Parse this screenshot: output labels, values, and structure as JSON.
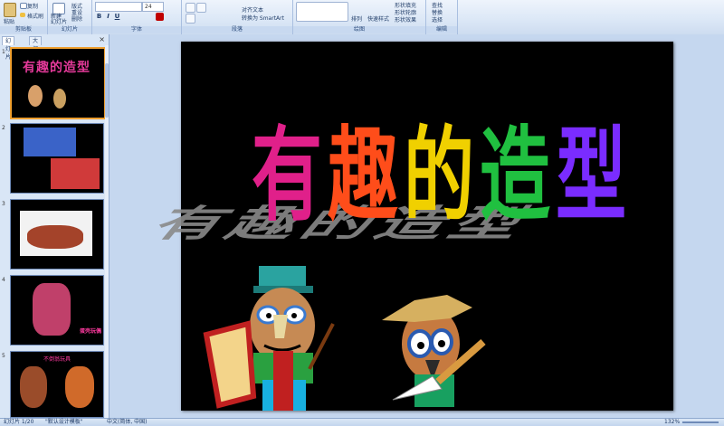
{
  "ribbon": {
    "groups": [
      {
        "label": "剪贴板"
      },
      {
        "label": "幻灯片"
      },
      {
        "label": "字体"
      },
      {
        "label": "段落"
      },
      {
        "label": "绘图"
      },
      {
        "label": "编辑"
      }
    ],
    "paste_label": "粘贴",
    "copy_label": "复制",
    "format_painter_label": "格式刷",
    "new_slide_label": "新建\n幻灯片",
    "layout_label": "版式",
    "reset_label": "重设",
    "delete_label": "删除",
    "font_size_value": "24",
    "text_align_label": "对齐文本",
    "smartart_label": "转换为 SmartArt",
    "arrange_label": "排列",
    "quick_styles_label": "快速样式",
    "shape_fill_label": "形状填充",
    "shape_outline_label": "形状轮廓",
    "shape_effects_label": "形状效果",
    "find_label": "查找",
    "replace_label": "替换",
    "select_label": "选择",
    "bold": "B",
    "italic": "I",
    "underline": "U"
  },
  "panel": {
    "tab_slides": "幻灯片",
    "tab_outline": "大纲",
    "close": "×",
    "thumbnails": [
      {
        "num": "1",
        "caption": "有趣的造型"
      },
      {
        "num": "2",
        "caption": ""
      },
      {
        "num": "3",
        "caption": ""
      },
      {
        "num": "4",
        "caption": "蛋壳玩偶"
      },
      {
        "num": "5",
        "caption": "不倒翁玩具"
      }
    ]
  },
  "slide": {
    "title_chars": [
      {
        "ch": "有",
        "color": "#e0208a"
      },
      {
        "ch": "趣",
        "color": "#ff4d1a"
      },
      {
        "ch": "的",
        "color": "#f0d000"
      },
      {
        "ch": "造",
        "color": "#20c040"
      },
      {
        "ch": "型",
        "color": "#7a2cff"
      }
    ],
    "shadow_text": "有趣的造型"
  },
  "status": {
    "slide_info": "幻灯片 1/20",
    "theme": "\"默认设计模板\"",
    "language": "中文(简体, 中国)",
    "zoom": "132%"
  }
}
